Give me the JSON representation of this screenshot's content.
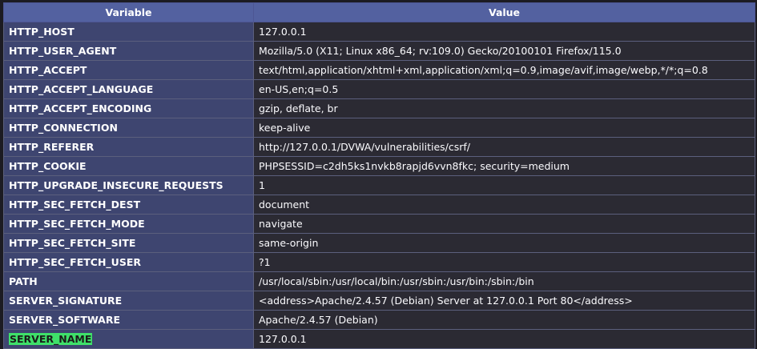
{
  "table": {
    "headers": {
      "variable": "Variable",
      "value": "Value"
    },
    "rows": [
      {
        "name": "HTTP_HOST",
        "value": "127.0.0.1"
      },
      {
        "name": "HTTP_USER_AGENT",
        "value": "Mozilla/5.0 (X11; Linux x86_64; rv:109.0) Gecko/20100101 Firefox/115.0"
      },
      {
        "name": "HTTP_ACCEPT",
        "value": "text/html,application/xhtml+xml,application/xml;q=0.9,image/avif,image/webp,*/*;q=0.8"
      },
      {
        "name": "HTTP_ACCEPT_LANGUAGE",
        "value": "en-US,en;q=0.5"
      },
      {
        "name": "HTTP_ACCEPT_ENCODING",
        "value": "gzip, deflate, br"
      },
      {
        "name": "HTTP_CONNECTION",
        "value": "keep-alive"
      },
      {
        "name": "HTTP_REFERER",
        "value": "http://127.0.0.1/DVWA/vulnerabilities/csrf/"
      },
      {
        "name": "HTTP_COOKIE",
        "value": "PHPSESSID=c2dh5ks1nvkb8rapjd6vvn8fkc; security=medium"
      },
      {
        "name": "HTTP_UPGRADE_INSECURE_REQUESTS",
        "value": "1"
      },
      {
        "name": "HTTP_SEC_FETCH_DEST",
        "value": "document"
      },
      {
        "name": "HTTP_SEC_FETCH_MODE",
        "value": "navigate"
      },
      {
        "name": "HTTP_SEC_FETCH_SITE",
        "value": "same-origin"
      },
      {
        "name": "HTTP_SEC_FETCH_USER",
        "value": "?1"
      },
      {
        "name": "PATH",
        "value": "/usr/local/sbin:/usr/local/bin:/usr/sbin:/usr/bin:/sbin:/bin"
      },
      {
        "name": "SERVER_SIGNATURE",
        "value": "<address>Apache/2.4.57 (Debian) Server at 127.0.0.1 Port 80</address>"
      },
      {
        "name": "SERVER_SOFTWARE",
        "value": "Apache/2.4.57 (Debian)"
      },
      {
        "name": "SERVER_NAME",
        "value": "127.0.0.1"
      }
    ]
  },
  "highlight": {
    "text": "SERVER_NAME",
    "color": "#3fe06a"
  },
  "colors": {
    "header_bg": "#5361a0",
    "key_bg": "#3e4570",
    "value_bg": "#2b2a33"
  }
}
